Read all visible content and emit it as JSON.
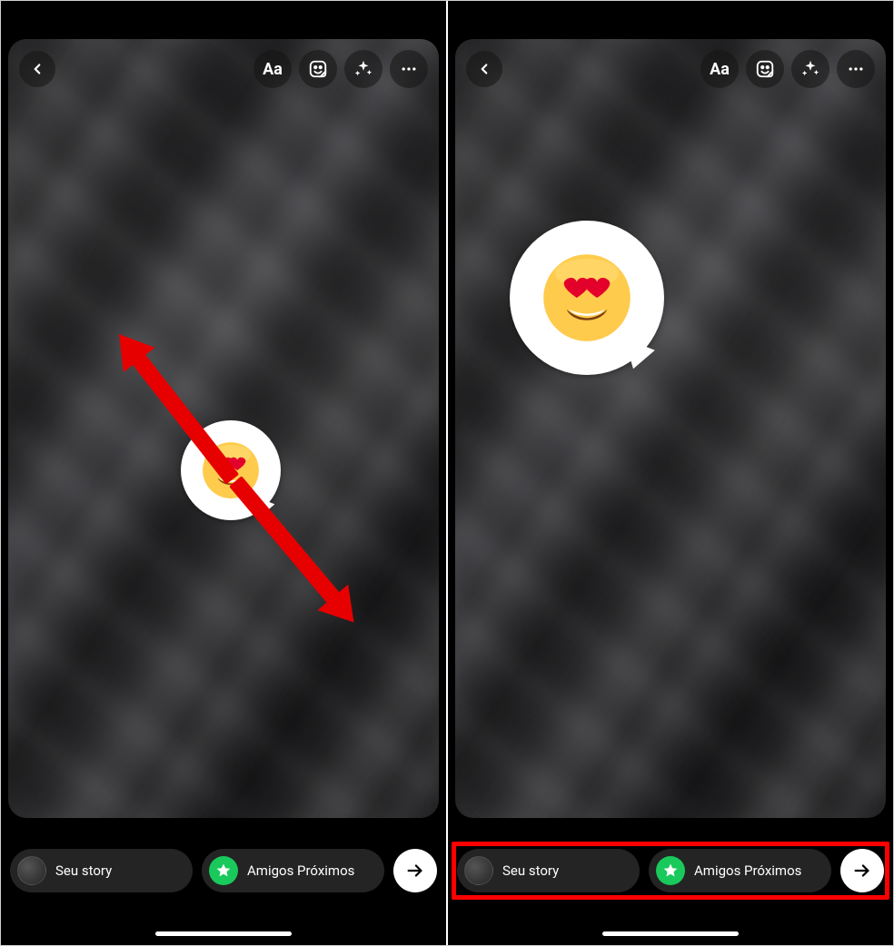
{
  "editor": {
    "tools": {
      "back_icon": "back",
      "text_label": "Aa",
      "sticker_icon": "sticker",
      "effects_icon": "sparkles",
      "more_icon": "more"
    }
  },
  "sticker": {
    "emoji_name": "smiling-face-with-heart-eyes"
  },
  "annotations": {
    "left_panel_arrows": "pinch-to-resize",
    "right_panel_highlight": "share-buttons"
  },
  "share": {
    "your_story_label": "Seu story",
    "close_friends_label": "Amigos Próximos",
    "next_icon": "arrow-right"
  }
}
